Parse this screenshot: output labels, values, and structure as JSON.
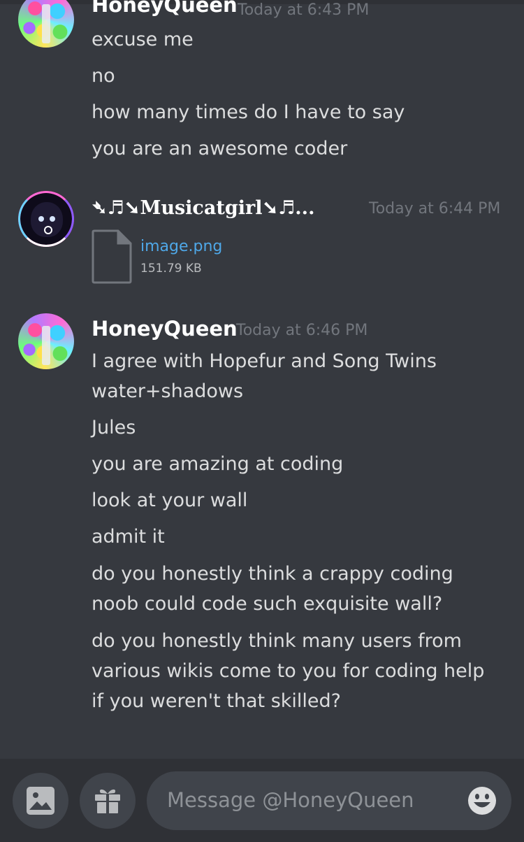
{
  "messages": [
    {
      "author": "HoneyQueen",
      "timestamp": "Today at 6:43 PM",
      "lines": [
        "excuse me",
        "no",
        "how many times do I have to say",
        "you are an awesome coder"
      ]
    },
    {
      "author": "➴♬➘Musicatgirl➘♬...",
      "timestamp": "Today at 6:44 PM",
      "attachment": {
        "name": "image.png",
        "size": "151.79 KB"
      }
    },
    {
      "author": "HoneyQueen",
      "timestamp": "Today at 6:46 PM",
      "lines": [
        "I agree with Hopefur and Song Twins",
        "water+shadows",
        "Jules",
        "you are amazing at coding",
        "look at your wall",
        "admit it",
        "do you honestly think a crappy coding",
        "noob could code such exquisite wall?",
        "do you honestly think many users from",
        "various wikis come to you for coding help",
        "if you weren't that skilled?"
      ]
    }
  ],
  "composer": {
    "placeholder": "Message @HoneyQueen",
    "image_button_icon": "image-icon",
    "gift_button_icon": "gift-icon",
    "emoji_button_icon": "emoji-icon"
  },
  "colors": {
    "background": "#36393f",
    "composer_bg": "#2f3136",
    "input_bg": "#40444b",
    "link": "#4fa8e8",
    "timestamp": "#72767d"
  }
}
